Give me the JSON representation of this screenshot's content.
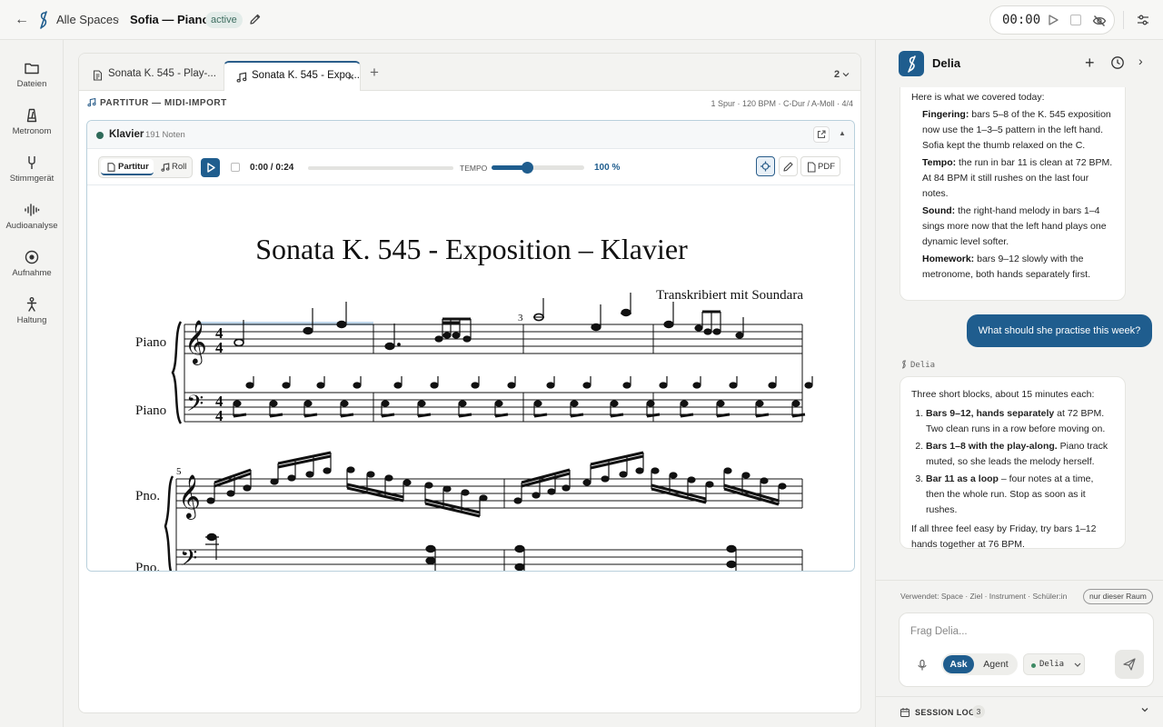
{
  "topbar": {
    "back_label": "←",
    "spaces_label": "Alle Spaces",
    "separator": "›",
    "title": "Sofia — Piano",
    "status_badge": "active",
    "timer_display": "00:00"
  },
  "rail": {
    "items": [
      {
        "label": "Dateien",
        "icon": "folder-icon"
      },
      {
        "label": "Metronom",
        "icon": "metronome-icon"
      },
      {
        "label": "Stimmgerät",
        "icon": "tuning-fork-icon"
      },
      {
        "label": "Audioanalyse",
        "icon": "waveform-icon"
      },
      {
        "label": "Aufnahme",
        "icon": "record-icon"
      },
      {
        "label": "Haltung",
        "icon": "posture-icon"
      }
    ]
  },
  "tabs": {
    "items": [
      {
        "label": "Sonata K. 545 - Play-...",
        "icon": "document-icon",
        "active": false
      },
      {
        "label": "Sonata K. 545 - Expo...",
        "icon": "music-note-icon",
        "active": true
      }
    ],
    "close_label": "×",
    "add_label": "+",
    "count_label": "2"
  },
  "score": {
    "header": "PARTITUR — MIDI-IMPORT",
    "meta": "1 Spur · 120 BPM · C-Dur / A-Moll · 4/4",
    "instrument": "Klavier",
    "note_count": "191 Noten",
    "view_partitur": "Partitur",
    "view_roll": "Roll",
    "time": "0:00 / 0:24",
    "progress": 0,
    "tempo_label": "TEMPO",
    "tempo_value": "100 %",
    "tempo_fraction": 0.38,
    "pdf_label": "PDF",
    "sheet": {
      "title": "Sonata K. 545 - Exposition – Klavier",
      "subtitle": "Transkribiert mit Soundara",
      "staff_labels": [
        "Piano",
        "Piano",
        "Pno.",
        "Pno."
      ],
      "measure_numbers": [
        "3",
        "5"
      ],
      "time_signature": "4/4"
    }
  },
  "assistant": {
    "name": "Delia",
    "message1": {
      "intro": "Here is what we covered today:",
      "points": [
        {
          "head": "Fingering:",
          "text": " bars 5–8 of the K. 545 exposition now use the 1–3–5 pattern in the left hand. Sofia kept the thumb relaxed on the C."
        },
        {
          "head": "Tempo:",
          "text": " the run in bar 11 is clean at 72 BPM. At 84 BPM it still rushes on the last four notes."
        },
        {
          "head": "Sound:",
          "text": " the right-hand melody in bars 1–4 sings more now that the left hand plays one dynamic level softer."
        },
        {
          "head": "Homework:",
          "text": " bars 9–12 slowly with the metronome, both hands separately first."
        }
      ]
    },
    "user_message": "What should she practise this week?",
    "speaker": "Delia",
    "message2": {
      "intro": "Three short blocks, about 15 minutes each:",
      "steps": [
        {
          "head": "Bars 9–12, hands separately",
          "text": " at 72 BPM. Two clean runs in a row before moving on."
        },
        {
          "head": "Bars 1–8 with the play-along.",
          "text": " Piano track muted, so she leads the melody herself."
        },
        {
          "head": "Bar 11 as a loop",
          "text": " – four notes at a time, then the whole run. Stop as soon as it rushes."
        }
      ],
      "outro": "If all three feel easy by Friday, try bars 1–12 hands together at 76 BPM."
    },
    "used_label": "Verwendet: Space · Ziel · Instrument · Schüler:in",
    "scope_label": "nur dieser Raum",
    "composer_placeholder": "Frag Delia...",
    "mode_ask": "Ask",
    "mode_agent": "Agent",
    "model_label": "Delia",
    "session_log_label": "SESSION LOG",
    "session_log_count": "3"
  },
  "colors": {
    "accent": "#1f5d8e",
    "badge_bg": "#e3ece9",
    "instrument_dot": "#2f6a5a"
  }
}
